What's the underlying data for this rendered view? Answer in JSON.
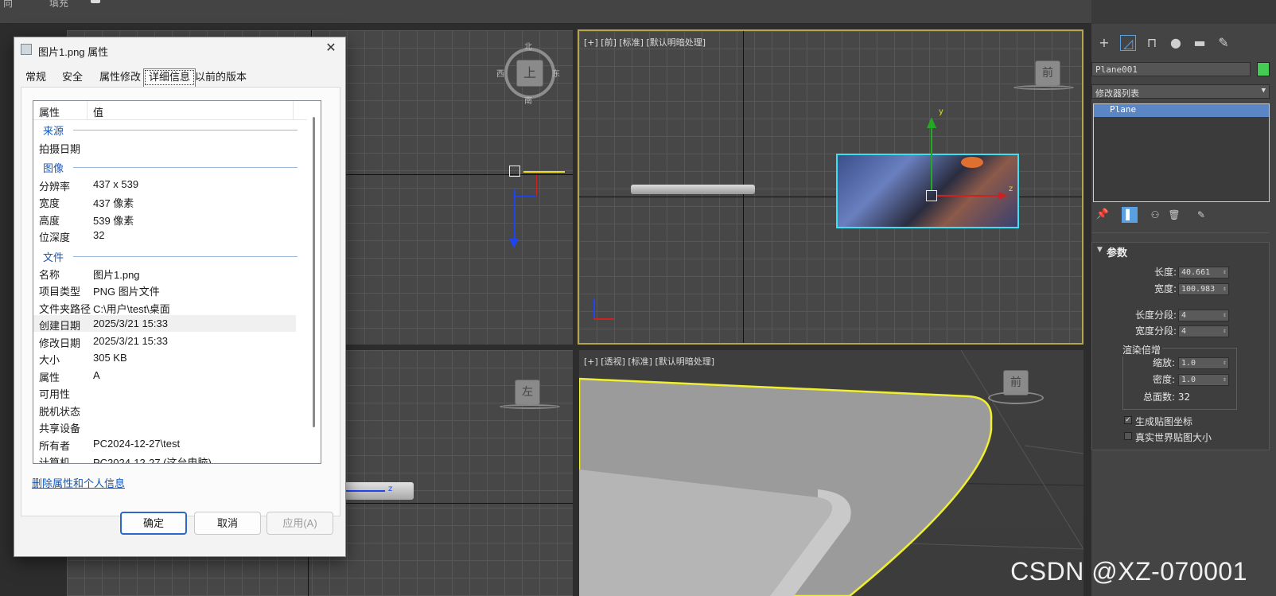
{
  "topbar": {
    "left_text": "向",
    "mid_text": "填充"
  },
  "viewports": {
    "front_label": "[+] [前] [标准] [默认明暗处理]",
    "persp_label": "[+] [透视] [标准] [默认明暗处理]",
    "cube_top": "上",
    "cube_top_n": "北",
    "cube_top_s": "南",
    "cube_top_w": "西",
    "cube_top_e": "东",
    "cube_left": "左",
    "cube_front": "前",
    "cube_persp": "前",
    "axis_z": "z",
    "axis_y": "y"
  },
  "command_panel": {
    "object_name": "Plane001",
    "object_color": "#44cc55",
    "modifier_list": "修改器列表",
    "stack_items": [
      "Plane"
    ],
    "rollout_title": "参数",
    "params": [
      {
        "label": "长度:",
        "value": "40.661"
      },
      {
        "label": "宽度:",
        "value": "100.983"
      },
      {
        "label": "长度分段:",
        "value": "4"
      },
      {
        "label": "宽度分段:",
        "value": "4"
      }
    ],
    "render_group": "渲染倍增",
    "scale_label": "缩放:",
    "scale_value": "1.0",
    "density_label": "密度:",
    "density_value": "1.0",
    "total_faces": "总面数: 32",
    "checkbox_gen": "生成贴图坐标",
    "checkbox_real": "真实世界贴图大小"
  },
  "dialog": {
    "title": "图片1.png 属性",
    "tabs": [
      "常规",
      "安全",
      "属性修改",
      "详细信息",
      "以前的版本"
    ],
    "active_tab": "详细信息",
    "col_property": "属性",
    "col_value": "值",
    "groups": {
      "source": "来源",
      "image": "图像",
      "file": "文件"
    },
    "rows": [
      {
        "k": "拍摄日期",
        "v": ""
      },
      {
        "k": "分辨率",
        "v": "437 x 539"
      },
      {
        "k": "宽度",
        "v": "437 像素"
      },
      {
        "k": "高度",
        "v": "539 像素"
      },
      {
        "k": "位深度",
        "v": "32"
      },
      {
        "k": "名称",
        "v": "图片1.png"
      },
      {
        "k": "项目类型",
        "v": "PNG 图片文件"
      },
      {
        "k": "文件夹路径",
        "v": "C:\\用户\\test\\桌面"
      },
      {
        "k": "创建日期",
        "v": "2025/3/21 15:33"
      },
      {
        "k": "修改日期",
        "v": "2025/3/21 15:33"
      },
      {
        "k": "大小",
        "v": "305 KB"
      },
      {
        "k": "属性",
        "v": "A"
      },
      {
        "k": "可用性",
        "v": ""
      },
      {
        "k": "脱机状态",
        "v": ""
      },
      {
        "k": "共享设备",
        "v": ""
      },
      {
        "k": "所有者",
        "v": "PC2024-12-27\\test"
      },
      {
        "k": "计算机",
        "v": "PC2024-12-27 (这台电脑)"
      }
    ],
    "remove_link": "删除属性和个人信息",
    "ok": "确定",
    "cancel": "取消",
    "apply": "应用(A)"
  },
  "watermark": "CSDN @XZ-070001"
}
